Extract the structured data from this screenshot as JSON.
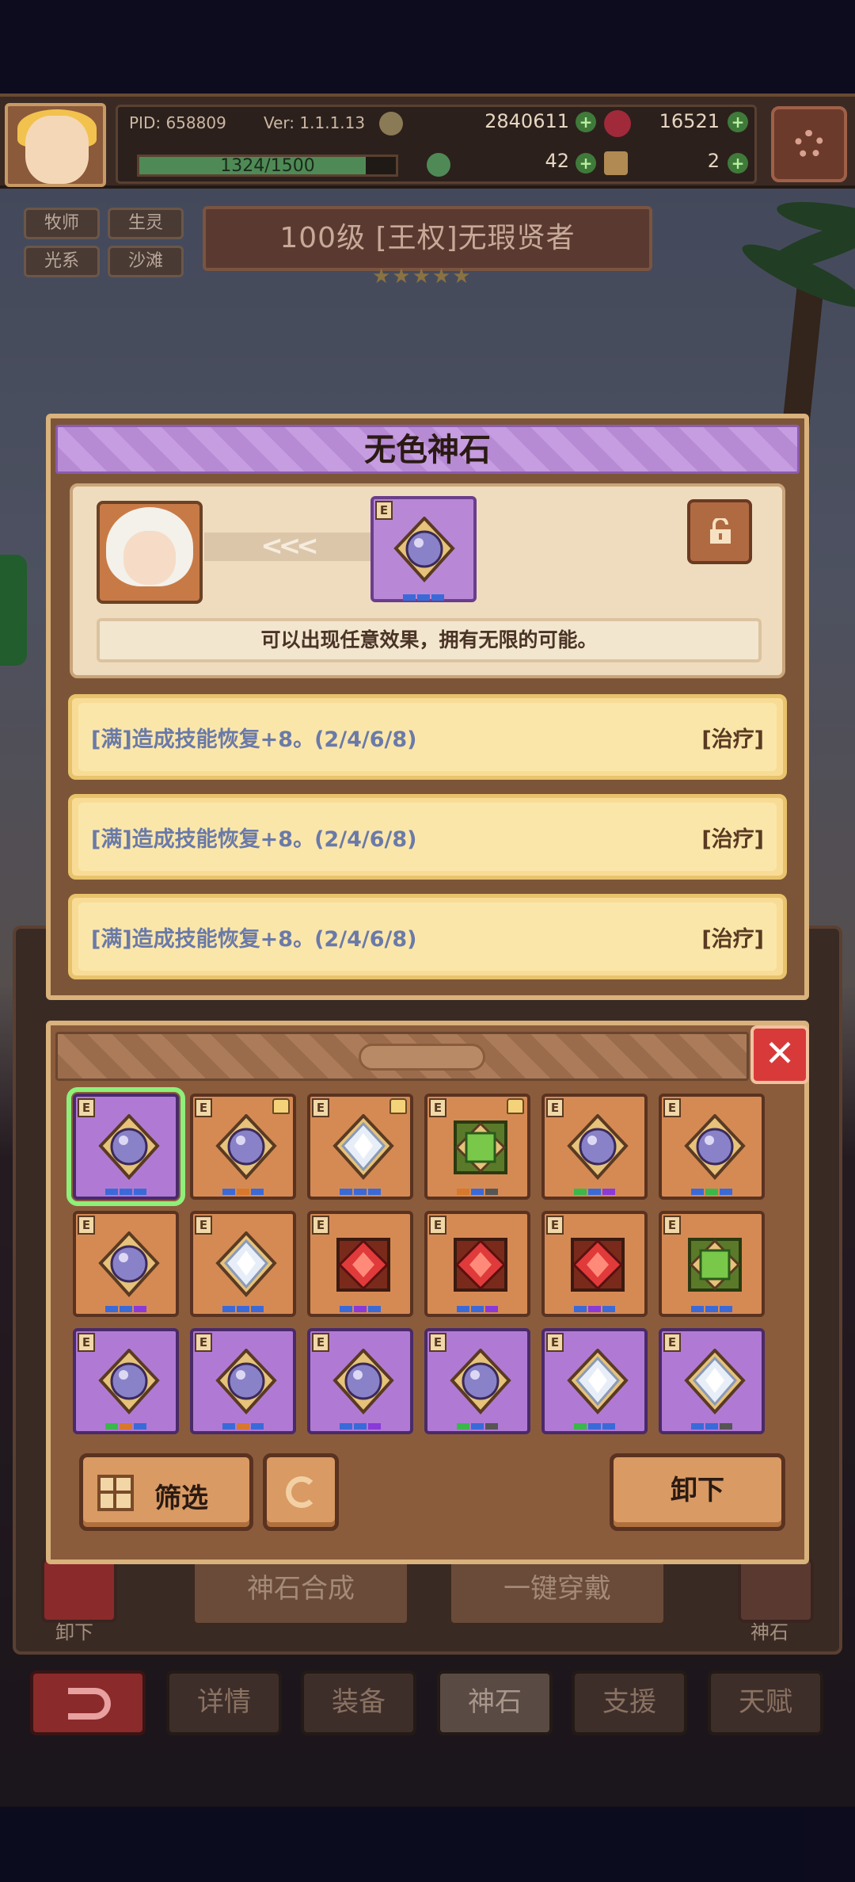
{
  "hud": {
    "pid": "PID: 658809",
    "version": "Ver: 1.1.1.13",
    "gold": "2840611",
    "gems": "16521",
    "exp": "1324/1500",
    "exp_fraction": 0.883,
    "clover": "42",
    "key": "2",
    "settings_icon": "gear-icon"
  },
  "tags": [
    "牧师",
    "生灵",
    "光系",
    "沙滩"
  ],
  "hero_title": "100级  [王权]无瑕贤者",
  "stars": "★★★★★",
  "detail": {
    "title": "无色神石",
    "arrows": "<<<",
    "rank": "E",
    "description": "可以出现任意效果，拥有无限的可能。",
    "effects": [
      {
        "text": "[满]造成技能恢复+8。(2/4/6/8)",
        "tag": "[治疗]"
      },
      {
        "text": "[满]造成技能恢复+8。(2/4/6/8)",
        "tag": "[治疗]"
      },
      {
        "text": "[满]造成技能恢复+8。(2/4/6/8)",
        "tag": "[治疗]"
      }
    ]
  },
  "inventory": {
    "close": "✕",
    "slots": [
      {
        "bg": "purple",
        "gem": "pearl",
        "locked": false,
        "selected": true,
        "pips": [
          "#3a6ad8",
          "#3a6ad8",
          "#3a6ad8"
        ]
      },
      {
        "bg": "orange",
        "gem": "pearl",
        "locked": true,
        "selected": false,
        "pips": [
          "#3a6ad8",
          "#d8782a",
          "#3a6ad8"
        ]
      },
      {
        "bg": "orange",
        "gem": "diamond",
        "locked": true,
        "selected": false,
        "pips": [
          "#3a6ad8",
          "#3a6ad8",
          "#3a6ad8"
        ]
      },
      {
        "bg": "orange",
        "gem": "emerald",
        "locked": true,
        "selected": false,
        "pips": [
          "#d8782a",
          "#3a6ad8",
          "#555555"
        ]
      },
      {
        "bg": "orange",
        "gem": "pearl",
        "locked": false,
        "selected": false,
        "pips": [
          "#3ab84a",
          "#3a6ad8",
          "#8a3ad8"
        ]
      },
      {
        "bg": "orange",
        "gem": "pearl",
        "locked": false,
        "selected": false,
        "pips": [
          "#3a6ad8",
          "#3ab84a",
          "#3a6ad8"
        ]
      },
      {
        "bg": "orange",
        "gem": "pearl",
        "locked": false,
        "selected": false,
        "pips": [
          "#3a6ad8",
          "#3a6ad8",
          "#8a3ad8"
        ]
      },
      {
        "bg": "orange",
        "gem": "diamond",
        "locked": false,
        "selected": false,
        "pips": [
          "#3a6ad8",
          "#3a6ad8",
          "#3a6ad8"
        ]
      },
      {
        "bg": "orange",
        "gem": "ruby",
        "locked": false,
        "selected": false,
        "pips": [
          "#3a6ad8",
          "#8a3ad8",
          "#3a6ad8"
        ]
      },
      {
        "bg": "orange",
        "gem": "ruby",
        "locked": false,
        "selected": false,
        "pips": [
          "#3a6ad8",
          "#3a6ad8",
          "#8a3ad8"
        ]
      },
      {
        "bg": "orange",
        "gem": "ruby",
        "locked": false,
        "selected": false,
        "pips": [
          "#3a6ad8",
          "#8a3ad8",
          "#3a6ad8"
        ]
      },
      {
        "bg": "orange",
        "gem": "emerald",
        "locked": false,
        "selected": false,
        "pips": [
          "#3a6ad8",
          "#3a6ad8",
          "#3a6ad8"
        ]
      },
      {
        "bg": "purple",
        "gem": "pearl",
        "locked": false,
        "selected": false,
        "pips": [
          "#3ab84a",
          "#d8782a",
          "#3a6ad8"
        ]
      },
      {
        "bg": "purple",
        "gem": "pearl",
        "locked": false,
        "selected": false,
        "pips": [
          "#3a6ad8",
          "#d8782a",
          "#3a6ad8"
        ]
      },
      {
        "bg": "purple",
        "gem": "pearl",
        "locked": false,
        "selected": false,
        "pips": [
          "#3a6ad8",
          "#3a6ad8",
          "#8a3ad8"
        ]
      },
      {
        "bg": "purple",
        "gem": "pearl",
        "locked": false,
        "selected": false,
        "pips": [
          "#3ab84a",
          "#3a6ad8",
          "#555555"
        ]
      },
      {
        "bg": "purple",
        "gem": "diamond",
        "locked": false,
        "selected": false,
        "pips": [
          "#3ab84a",
          "#3a6ad8",
          "#3a6ad8"
        ]
      },
      {
        "bg": "purple",
        "gem": "diamond",
        "locked": false,
        "selected": false,
        "pips": [
          "#3a6ad8",
          "#3a6ad8",
          "#555555"
        ]
      }
    ],
    "filter_label": "筛选",
    "unequip_label": "卸下"
  },
  "lower": {
    "synth_label": "神石合成",
    "equip_all_label": "一键穿戴",
    "side_left_label": "卸下",
    "side_right_label": "神石"
  },
  "tabs": [
    "详情",
    "装备",
    "神石",
    "支援",
    "天赋"
  ],
  "colors": {
    "accent_purple": "#b888d6",
    "panel_gold": "#f8dc96",
    "close_red": "#d83a3a"
  }
}
